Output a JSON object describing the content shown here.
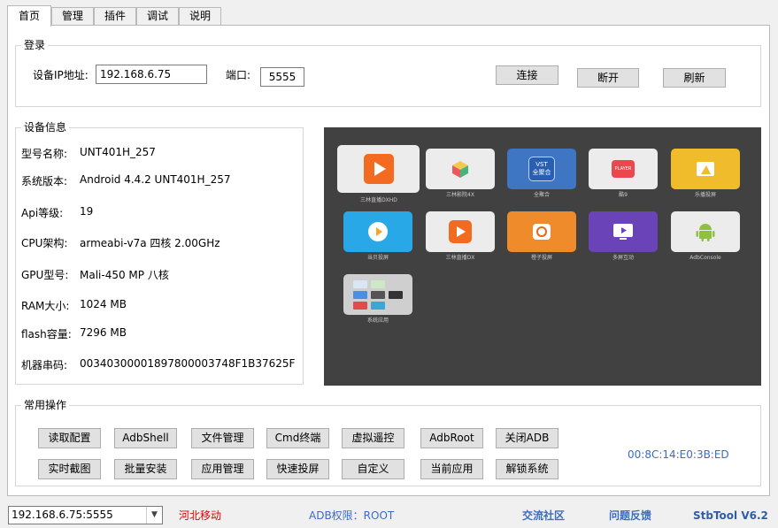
{
  "tabs": [
    {
      "label": "首页"
    },
    {
      "label": "管理"
    },
    {
      "label": "插件"
    },
    {
      "label": "调试"
    },
    {
      "label": "说明"
    }
  ],
  "login": {
    "title": "登录",
    "ip_label": "设备IP地址:",
    "ip_value": "192.168.6.75",
    "port_label": "端口:",
    "port_value": "5555",
    "connect": "连接",
    "disconnect": "断开",
    "refresh": "刷新"
  },
  "device_info": {
    "title": "设备信息",
    "rows": [
      {
        "key": "型号名称:",
        "value": "UNT401H_257"
      },
      {
        "key": "系统版本:",
        "value": "Android 4.4.2 UNT401H_257"
      },
      {
        "key": "Api等级:",
        "value": "19"
      },
      {
        "key": "CPU架构:",
        "value": "armeabi-v7a 四核 2.00GHz"
      },
      {
        "key": "GPU型号:",
        "value": "Mali-450 MP 八核"
      },
      {
        "key": "RAM大小:",
        "value": "1024 MB"
      },
      {
        "key": "flash容量:",
        "value": "7296 MB"
      },
      {
        "key": "机器串码:",
        "value": "00340300001897800003748F1B37625F"
      }
    ]
  },
  "screen": {
    "apps": [
      {
        "label": "三林直播DXHD",
        "icon": "play-icon",
        "bg": "#ececec",
        "accent": "#f36b21"
      },
      {
        "label": "三林影院4X",
        "icon": "cube-icon",
        "bg": "#ececec",
        "accent": "#7fc46a"
      },
      {
        "label": "全聚合",
        "icon": "vst-icon",
        "bg": "#3f76c4",
        "accent": "#2a5fb0"
      },
      {
        "label": "酷9",
        "icon": "player-icon",
        "bg": "#ececec",
        "accent": "#e9484f"
      },
      {
        "label": "乐播投屏",
        "icon": "lebo-icon",
        "bg": "#f1bc2c",
        "accent": "#f1bc2c"
      },
      {
        "label": "当贝投屏",
        "icon": "dangbei-icon",
        "bg": "#29a8e8",
        "accent": "#29a8e8"
      },
      {
        "label": "三林直播DX",
        "icon": "play-icon",
        "bg": "#ececec",
        "accent": "#f36b21"
      },
      {
        "label": "橙子投屏",
        "icon": "orange-cast-icon",
        "bg": "#f08b2c",
        "accent": "#e06a1a"
      },
      {
        "label": "多屏互动",
        "icon": "multiscreen-icon",
        "bg": "#6a43b8",
        "accent": "#5532a3"
      },
      {
        "label": "AdbConsole",
        "icon": "android-icon",
        "bg": "#ececec",
        "accent": "#8cc240"
      },
      {
        "label": "系统应用",
        "icon": "folder-icon",
        "bg": "#cfcfcf",
        "accent": "#9a9a9a"
      }
    ]
  },
  "ops": {
    "title": "常用操作",
    "row1": [
      "读取配置",
      "AdbShell",
      "文件管理",
      "Cmd终端",
      "虚拟遥控",
      "AdbRoot",
      "关闭ADB"
    ],
    "row2": [
      "实时截图",
      "批量安装",
      "应用管理",
      "快速投屏",
      "自定义",
      "当前应用",
      "解锁系统"
    ],
    "mac": "00:8C:14:E0:3B:ED"
  },
  "statusbar": {
    "device_select": "192.168.6.75:5555",
    "isp": "河北移动",
    "adb_perm": "ADB权限：ROOT",
    "community": "交流社区",
    "feedback": "问题反馈",
    "version": "StbTool V6.2"
  },
  "colors": {
    "isp": "#e00000",
    "link": "#3c6bc2",
    "mac": "#3c6bc2",
    "version": "#2e5ea8"
  }
}
